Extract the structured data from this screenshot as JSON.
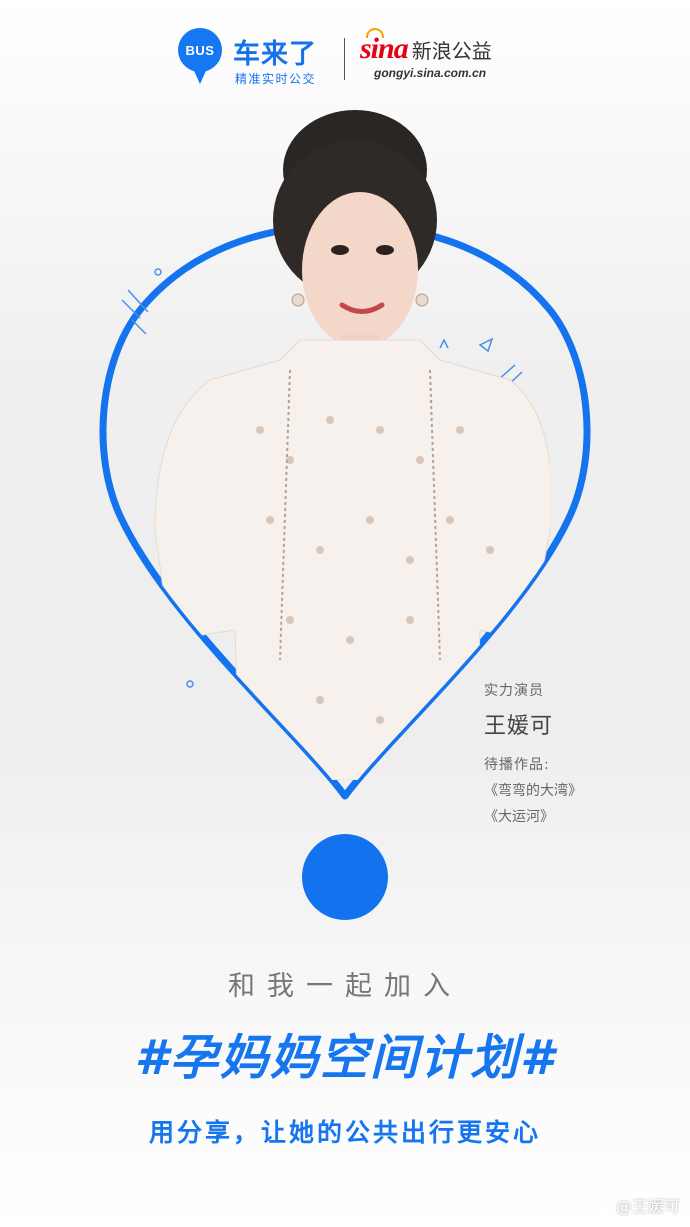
{
  "header": {
    "bus_badge": "BUS",
    "app_name": "车来了",
    "app_slogan": "精准实时公交",
    "partner_logo_word": "sina",
    "partner_name": "新浪公益",
    "partner_url": "gongyi.sina.com.cn"
  },
  "colors": {
    "brand_blue": "#1576f0",
    "sina_red": "#e60012",
    "text_gray": "#777777"
  },
  "bio": {
    "role": "实力演员",
    "name": "王媛可",
    "works_label": "待播作品:",
    "works": [
      "《弯弯的大湾》",
      "《大运河》"
    ]
  },
  "campaign": {
    "join_text": "和我一起加入",
    "hashtag": "#孕妈妈空间计划#",
    "tagline": "用分享，让她的公共出行更安心"
  },
  "watermark": {
    "text": "@王媛可",
    "icon": "weibo-icon"
  }
}
